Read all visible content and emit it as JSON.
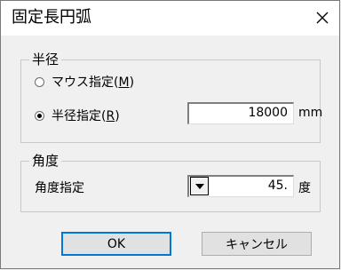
{
  "dialog": {
    "title": "固定長円弧",
    "close_icon": "close-icon"
  },
  "radius_group": {
    "label": "半径",
    "option_mouse": {
      "text": "マウス指定(",
      "mnemonic": "M",
      "suffix": ")",
      "checked": false
    },
    "option_radius": {
      "text": "半径指定(",
      "mnemonic": "R",
      "suffix": ")",
      "checked": true
    },
    "value": "18000",
    "unit": "mm"
  },
  "angle_group": {
    "label": "角度",
    "field_label": "角度指定",
    "value": "45.",
    "unit": "度",
    "dropdown_icon": "dropdown-arrow-icon"
  },
  "buttons": {
    "ok": "OK",
    "cancel": "キャンセル"
  }
}
